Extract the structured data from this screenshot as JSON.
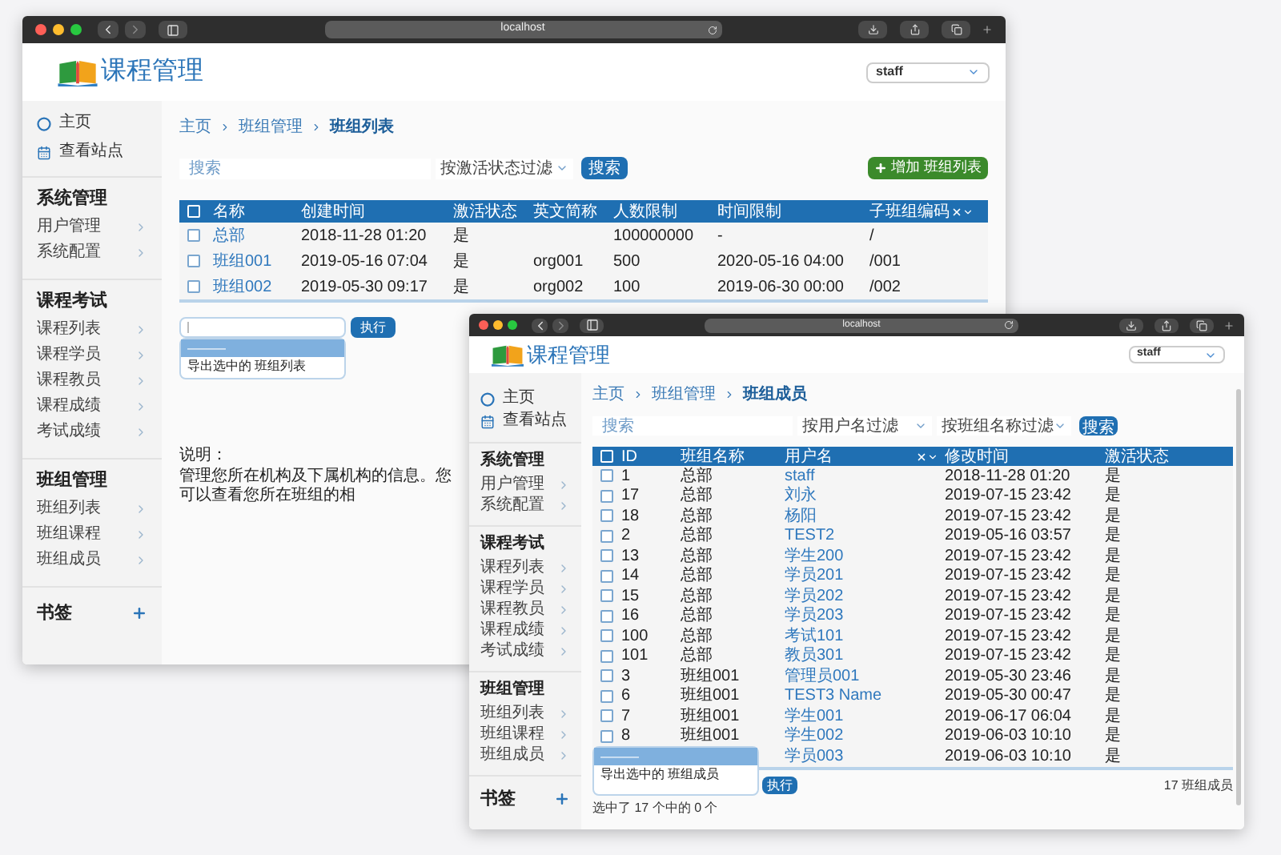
{
  "windows": [
    {
      "title_bar": {
        "address": "localhost"
      },
      "header": {
        "app_name": "课程管理",
        "user": "staff"
      },
      "sidebar": {
        "links": [
          "主页",
          "查看站点"
        ],
        "sections": [
          {
            "title": "系统管理",
            "items": [
              "用户管理",
              "系统配置"
            ]
          },
          {
            "title": "课程考试",
            "items": [
              "课程列表",
              "课程学员",
              "课程教员",
              "课程成绩",
              "考试成绩"
            ]
          },
          {
            "title": "班组管理",
            "items": [
              "班组列表",
              "班组课程",
              "班组成员"
            ]
          }
        ],
        "bookmarks": "书签"
      },
      "breadcrumb": [
        "主页",
        "班组管理",
        "班组列表"
      ],
      "search": {
        "placeholder": "搜索"
      },
      "filters": [
        "按激活状态过滤"
      ],
      "search_button": "搜索",
      "add_button": "增加 班组列表",
      "table": {
        "select_all": {
          "checked": false
        },
        "columns": [
          {
            "label": "名称",
            "kind": "link",
            "sorted": false
          },
          {
            "label": "创建时间",
            "kind": "text",
            "sorted": false
          },
          {
            "label": "激活状态",
            "kind": "text",
            "sorted": false
          },
          {
            "label": "英文简称",
            "kind": "text",
            "sorted": false
          },
          {
            "label": "人数限制",
            "kind": "text",
            "sorted": false
          },
          {
            "label": "时间限制",
            "kind": "text",
            "sorted": false
          },
          {
            "label": "子班组编码",
            "kind": "text",
            "sorted": true
          }
        ],
        "rows": [
          {
            "checked": false,
            "cells": [
              "总部",
              "2018-11-28 01:20",
              "是",
              null,
              "100000000",
              "-",
              "/"
            ]
          },
          {
            "checked": false,
            "cells": [
              "班组001",
              "2019-05-16 07:04",
              "是",
              "org001",
              "500",
              "2020-05-16 04:00",
              "/001"
            ]
          },
          {
            "checked": false,
            "cells": [
              "班组002",
              "2019-05-30 09:17",
              "是",
              "org002",
              "100",
              "2019-06-30 00:00",
              "/002"
            ]
          }
        ]
      },
      "actions": {
        "options": [
          {
            "label": "———",
            "selected": true
          },
          {
            "label": "导出选中的 班组列表",
            "selected": false
          }
        ],
        "run_button": "执行"
      },
      "note": {
        "label": "说明：",
        "text": "管理您所在机构及下属机构的信息。您可以查看您所在班组的相"
      }
    },
    {
      "title_bar": {
        "address": "localhost"
      },
      "header": {
        "app_name": "课程管理",
        "user": "staff"
      },
      "sidebar": {
        "links": [
          "主页",
          "查看站点"
        ],
        "sections": [
          {
            "title": "系统管理",
            "items": [
              "用户管理",
              "系统配置"
            ]
          },
          {
            "title": "课程考试",
            "items": [
              "课程列表",
              "课程学员",
              "课程教员",
              "课程成绩",
              "考试成绩"
            ]
          },
          {
            "title": "班组管理",
            "items": [
              "班组列表",
              "班组课程",
              "班组成员"
            ]
          }
        ],
        "bookmarks": "书签"
      },
      "breadcrumb": [
        "主页",
        "班组管理",
        "班组成员"
      ],
      "search": {
        "placeholder": "搜索"
      },
      "filters": [
        "按用户名过滤",
        "按班组名称过滤"
      ],
      "search_button": "搜索",
      "table": {
        "select_all": {
          "checked": false
        },
        "columns": [
          {
            "label": "ID",
            "kind": "text",
            "sorted": false
          },
          {
            "label": "班组名称",
            "kind": "text",
            "sorted": false
          },
          {
            "label": "用户名",
            "kind": "link",
            "sorted": true
          },
          {
            "label": "修改时间",
            "kind": "text",
            "sorted": false
          },
          {
            "label": "激活状态",
            "kind": "text",
            "sorted": false
          }
        ],
        "rows": [
          {
            "checked": false,
            "cells": [
              "1",
              "总部",
              "staff",
              "2018-11-28 01:20",
              "是"
            ]
          },
          {
            "checked": false,
            "cells": [
              "17",
              "总部",
              "刘永",
              "2019-07-15 23:42",
              "是"
            ]
          },
          {
            "checked": false,
            "cells": [
              "18",
              "总部",
              "杨阳",
              "2019-07-15 23:42",
              "是"
            ]
          },
          {
            "checked": false,
            "cells": [
              "2",
              "总部",
              "TEST2",
              "2019-05-16 03:57",
              "是"
            ]
          },
          {
            "checked": false,
            "cells": [
              "13",
              "总部",
              "学生200",
              "2019-07-15 23:42",
              "是"
            ]
          },
          {
            "checked": false,
            "cells": [
              "14",
              "总部",
              "学员201",
              "2019-07-15 23:42",
              "是"
            ]
          },
          {
            "checked": false,
            "cells": [
              "15",
              "总部",
              "学员202",
              "2019-07-15 23:42",
              "是"
            ]
          },
          {
            "checked": false,
            "cells": [
              "16",
              "总部",
              "学员203",
              "2019-07-15 23:42",
              "是"
            ]
          },
          {
            "checked": false,
            "cells": [
              "100",
              "总部",
              "考试101",
              "2019-07-15 23:42",
              "是"
            ]
          },
          {
            "checked": false,
            "cells": [
              "101",
              "总部",
              "教员301",
              "2019-07-15 23:42",
              "是"
            ]
          },
          {
            "checked": false,
            "cells": [
              "3",
              "班组001",
              "管理员001",
              "2019-05-30 23:46",
              "是"
            ]
          },
          {
            "checked": false,
            "cells": [
              "6",
              "班组001",
              "TEST3 Name",
              "2019-05-30 00:47",
              "是"
            ]
          },
          {
            "checked": false,
            "cells": [
              "7",
              "班组001",
              "学生001",
              "2019-06-17 06:04",
              "是"
            ]
          },
          {
            "checked": false,
            "cells": [
              "8",
              "班组001",
              "学生002",
              "2019-06-03 10:10",
              "是"
            ]
          },
          {
            "cells": [
              null,
              null,
              "学员003",
              "2019-06-03 10:10",
              "是"
            ]
          }
        ]
      },
      "actions": {
        "options": [
          {
            "label": "———",
            "selected": true
          },
          {
            "label": "导出选中的 班组成员",
            "selected": false
          }
        ],
        "run_button": "执行"
      },
      "footer": {
        "selection": "选中了 17 个中的 0 个",
        "total": "17 班组成员"
      }
    }
  ]
}
